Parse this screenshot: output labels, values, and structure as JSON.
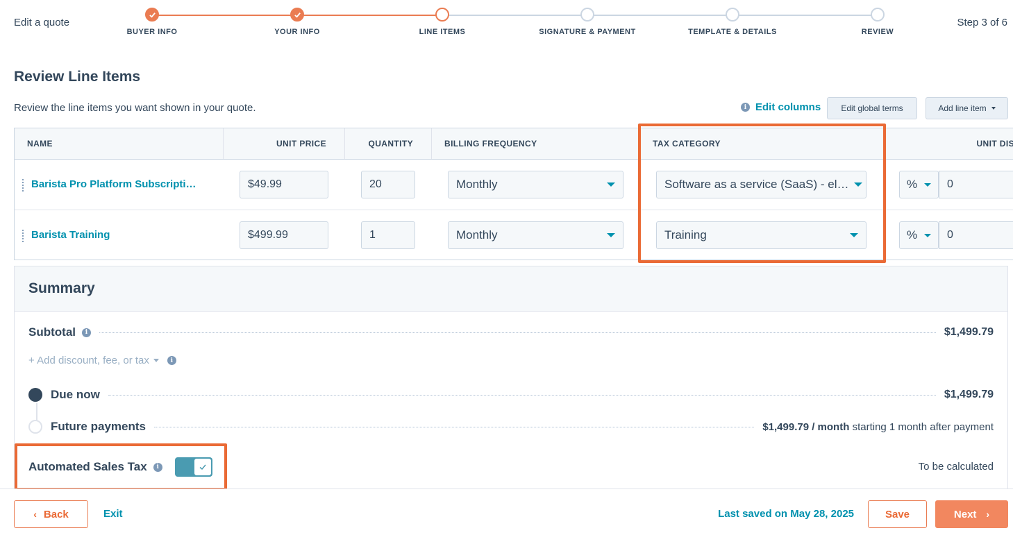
{
  "header": {
    "title": "Edit a quote",
    "step_count": "Step 3 of 6",
    "steps": [
      {
        "label": "BUYER INFO",
        "state": "done"
      },
      {
        "label": "YOUR INFO",
        "state": "done"
      },
      {
        "label": "LINE ITEMS",
        "state": "current"
      },
      {
        "label": "SIGNATURE & PAYMENT",
        "state": "upcoming"
      },
      {
        "label": "TEMPLATE & DETAILS",
        "state": "upcoming"
      },
      {
        "label": "REVIEW",
        "state": "upcoming"
      }
    ]
  },
  "section": {
    "title": "Review Line Items",
    "description": "Review the line items you want shown in your quote.",
    "edit_columns": "Edit columns",
    "edit_global_terms": "Edit global terms",
    "add_line_item": "Add line item"
  },
  "table": {
    "columns": [
      "NAME",
      "UNIT PRICE",
      "QUANTITY",
      "BILLING FREQUENCY",
      "TAX CATEGORY",
      "UNIT DIS"
    ],
    "rows": [
      {
        "name": "Barista Pro Platform Subscripti…",
        "unit_price": "$49.99",
        "quantity": "20",
        "billing_frequency": "Monthly",
        "tax_category": "Software as a service (SaaS) - el…",
        "discount_type": "%",
        "discount_value": "0"
      },
      {
        "name": "Barista Training",
        "unit_price": "$499.99",
        "quantity": "1",
        "billing_frequency": "Monthly",
        "tax_category": "Training",
        "discount_type": "%",
        "discount_value": "0"
      }
    ]
  },
  "summary": {
    "title": "Summary",
    "subtotal_label": "Subtotal",
    "subtotal_value": "$1,499.79",
    "add_discount": "+ Add discount, fee, or tax",
    "due_now_label": "Due now",
    "due_now_value": "$1,499.79",
    "future_label": "Future payments",
    "future_amount": "$1,499.79 / month",
    "future_suffix": "starting 1 month after payment",
    "auto_tax_label": "Automated Sales Tax",
    "auto_tax_enabled": true,
    "auto_tax_value": "To be calculated"
  },
  "footer": {
    "back": "Back",
    "exit": "Exit",
    "last_saved": "Last saved on May 28, 2025",
    "save": "Save",
    "next": "Next"
  },
  "colors": {
    "accent": "#ea7c52",
    "highlight": "#ea6a35",
    "link": "#0091ae",
    "text": "#33475b",
    "toggle": "#4a9bb1"
  }
}
